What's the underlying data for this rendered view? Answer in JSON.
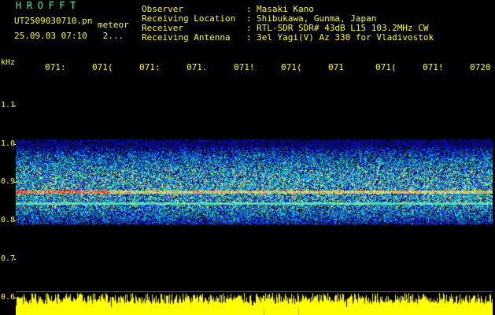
{
  "header": {
    "app_title": "HROFFT",
    "file_name": "UT2509030710.pn",
    "file_suffix": "meteor",
    "date_time": "25.09.03 07:10   2..."
  },
  "info": [
    {
      "label": "Observer",
      "value": "Masaki Kano"
    },
    {
      "label": "Receiving Location",
      "value": "Shibukawa, Gunma, Japan"
    },
    {
      "label": "Receiver",
      "value": "RTL-SDR SDR# 43dB L15 103.2MHz CW"
    },
    {
      "label": "Receiving Antenna",
      "value": "3el Yagi(V) Az 330 for Vladivostok"
    }
  ],
  "info_separator": ":",
  "spectrogram": {
    "y_unit": "kHz",
    "y_ticks": [
      "1.1",
      "1.0",
      "0.9",
      "0.8",
      "0.7",
      "0.6"
    ],
    "y_tick_values": [
      1.1,
      1.0,
      0.9,
      0.8,
      0.7,
      0.6
    ],
    "y_range": [
      0.595,
      1.17
    ],
    "x_labels": [
      "071:",
      "071(",
      "071:",
      "071.",
      "071!",
      "071(",
      "071",
      "071(",
      "071!",
      "0720"
    ],
    "noise_band_khz": [
      0.8,
      1.0
    ],
    "signal_line_khz": 0.875,
    "secondary_line_khz": 0.845,
    "colors": {
      "background": "#000000",
      "text": "#ffff00",
      "title": "#37ff8a",
      "signal": "#ff3030"
    }
  }
}
